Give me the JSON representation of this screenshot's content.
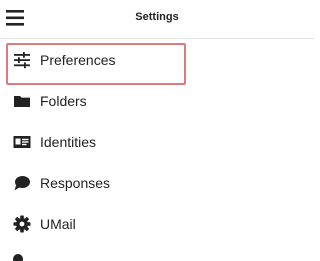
{
  "header": {
    "title": "Settings",
    "menu_icon": "hamburger-menu-icon"
  },
  "menu": {
    "selected": "Preferences",
    "items": [
      {
        "label": "Preferences",
        "icon": "sliders-icon"
      },
      {
        "label": "Folders",
        "icon": "folder-icon"
      },
      {
        "label": "Identities",
        "icon": "id-card-icon"
      },
      {
        "label": "Responses",
        "icon": "chat-bubble-icon"
      },
      {
        "label": "UMail",
        "icon": "gear-icon"
      }
    ]
  },
  "colors": {
    "highlight_border": "#e07a7a",
    "text": "#222222",
    "icon": "#222222"
  }
}
